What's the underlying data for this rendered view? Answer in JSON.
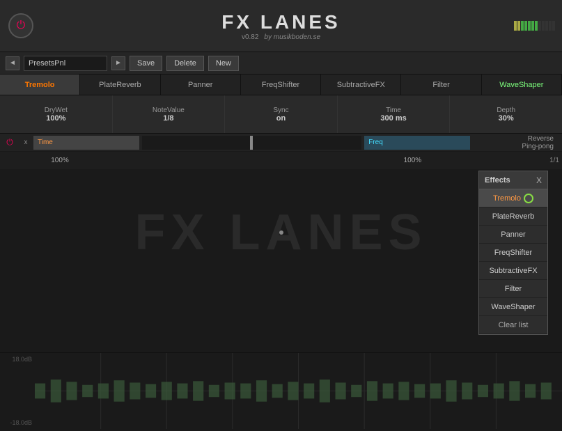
{
  "header": {
    "title": "FX LANES",
    "version": "v0.82",
    "subtitle": "by musikboden.se"
  },
  "preset_bar": {
    "preset_name": "PresetsPnl",
    "save_label": "Save",
    "delete_label": "Delete",
    "new_label": "New"
  },
  "fx_tabs": [
    {
      "id": "tremolo",
      "label": "Tremolo",
      "active": true
    },
    {
      "id": "platereverb",
      "label": "PlateReverb",
      "active": false
    },
    {
      "id": "panner",
      "label": "Panner",
      "active": false
    },
    {
      "id": "freqshifter",
      "label": "FreqShifter",
      "active": false
    },
    {
      "id": "subtractivefx",
      "label": "SubtractiveFX",
      "active": false
    },
    {
      "id": "filter",
      "label": "Filter",
      "active": false
    },
    {
      "id": "waveshaper",
      "label": "WaveShaper",
      "active": false,
      "green": true
    }
  ],
  "fx_params": [
    {
      "label": "DryWet",
      "value": "100%"
    },
    {
      "label": "NoteValue",
      "value": "1/8"
    },
    {
      "label": "Sync",
      "value": "on"
    },
    {
      "label": "Time",
      "value": "300 ms"
    },
    {
      "label": "Depth",
      "value": "30%"
    }
  ],
  "lane_row1": {
    "power_on": true,
    "close": "x",
    "number": "1/1",
    "bar1_text": "Time",
    "bar1_value": "100%",
    "bar2_marker": "|",
    "bar3_text": "Freq",
    "bar3_value": "100%",
    "reverse": "Reverse",
    "ping_pong": "Ping-pong"
  },
  "effects_popup": {
    "header": "Effects",
    "close": "X",
    "items": [
      {
        "id": "tremolo",
        "label": "Tremolo",
        "selected": true
      },
      {
        "id": "platereverb",
        "label": "PlateReverb",
        "selected": false
      },
      {
        "id": "panner",
        "label": "Panner",
        "selected": false
      },
      {
        "id": "freqshifter",
        "label": "FreqShifter",
        "selected": false
      },
      {
        "id": "subtractivefx",
        "label": "SubtractiveFX",
        "selected": false
      },
      {
        "id": "filter",
        "label": "Filter",
        "selected": false
      },
      {
        "id": "waveshaper",
        "label": "WaveShaper",
        "selected": false
      }
    ],
    "clear_label": "Clear list"
  },
  "canvas_title": "FX LANES",
  "waveform": {
    "label_top": "18.0dB",
    "label_bottom": "-18.0dB"
  }
}
